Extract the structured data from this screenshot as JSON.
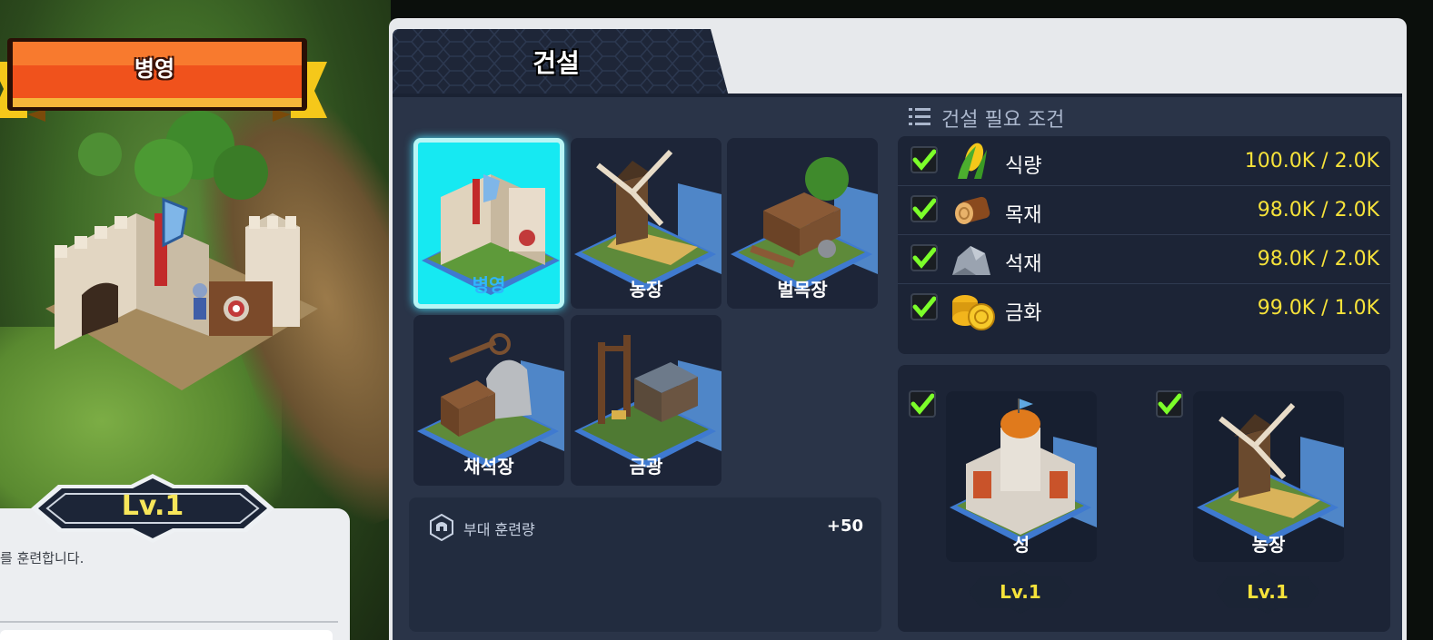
{
  "building_panel": {
    "title": "병영",
    "level": "Lv.1",
    "description": "를 훈련합니다."
  },
  "dialog": {
    "tab_label": "건설"
  },
  "buildings": [
    {
      "label": "병영",
      "selected": true
    },
    {
      "label": "농장",
      "selected": false
    },
    {
      "label": "벌목장",
      "selected": false
    },
    {
      "label": "채석장",
      "selected": false
    },
    {
      "label": "금광",
      "selected": false
    }
  ],
  "troop": {
    "label": "부대 훈련량",
    "value": "+50"
  },
  "requirements": {
    "title": "건설 필요 조건",
    "resources": [
      {
        "name": "식량",
        "value": "100.0K / 2.0K",
        "icon": "corn-icon",
        "met": true
      },
      {
        "name": "목재",
        "value": "98.0K / 2.0K",
        "icon": "log-icon",
        "met": true
      },
      {
        "name": "석재",
        "value": "98.0K / 2.0K",
        "icon": "stone-icon",
        "met": true
      },
      {
        "name": "금화",
        "value": "99.0K / 1.0K",
        "icon": "gold-coin-icon",
        "met": true
      }
    ],
    "prerequisites": [
      {
        "name": "성",
        "level": "Lv.1",
        "met": true
      },
      {
        "name": "농장",
        "level": "Lv.1",
        "met": true
      }
    ]
  },
  "colors": {
    "accent_yellow": "#f6e23a",
    "selected_cyan": "#16e9f2",
    "check_green": "#7cff2a",
    "panel_navy": "#2a3448"
  }
}
